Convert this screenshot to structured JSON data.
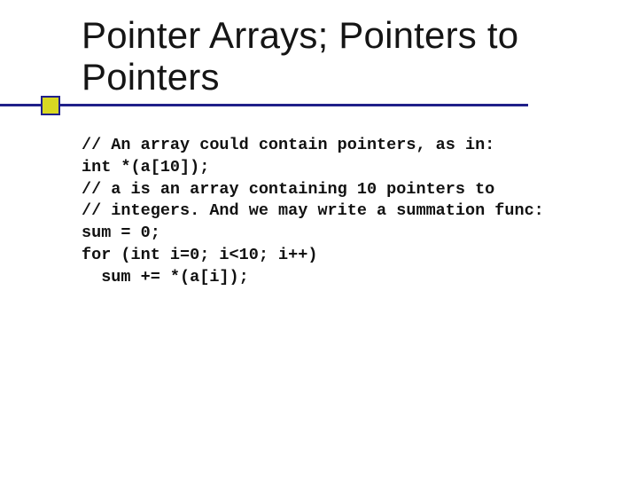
{
  "title": "Pointer Arrays; Pointers to Pointers",
  "code": {
    "l1": "// An array could contain pointers, as in:",
    "l2": "int *(a[10]);",
    "l3": "// a is an array containing 10 pointers to",
    "l4": "// integers. And we may write a summation func:",
    "l5": "sum = 0;",
    "l6": "for (int i=0; i<10; i++)",
    "l7": "  sum += *(a[i]);"
  }
}
